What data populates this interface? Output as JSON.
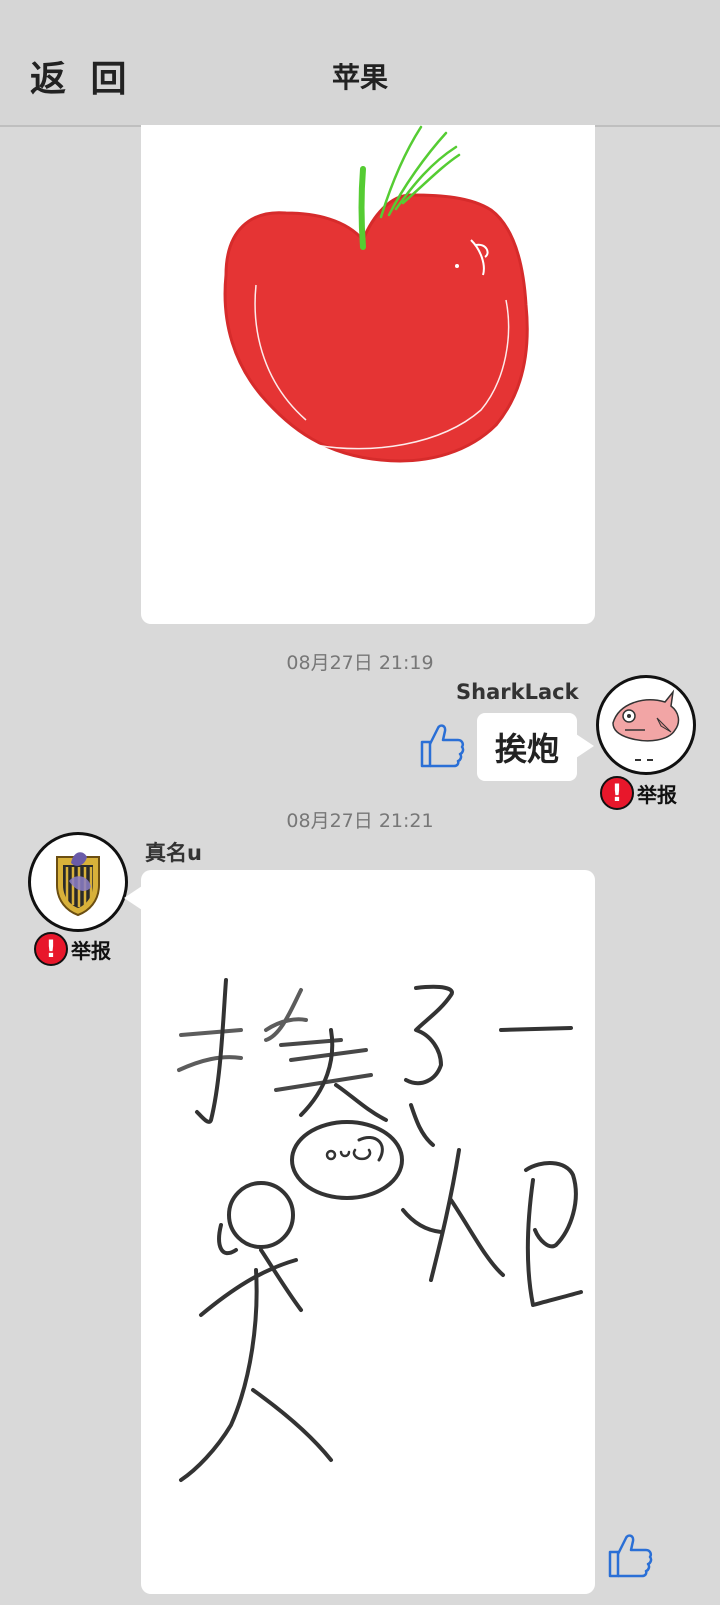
{
  "header": {
    "back_label": "返 回",
    "title": "苹果"
  },
  "messages": [
    {
      "type": "image",
      "image": "apple-drawing"
    },
    {
      "timestamp": "08月27日  21:19",
      "username": "SharkLack",
      "text": "挨炮",
      "report_label": "举报",
      "avatar": "shark-avatar"
    },
    {
      "timestamp": "08月27日  21:21",
      "username": "真名u",
      "image": "handwritten-drawing",
      "report_label": "举报",
      "avatar": "crest-avatar"
    }
  ],
  "colors": {
    "background": "#d9d9d9",
    "apple_red": "#e53434",
    "stem_green": "#55cc33",
    "thumb_blue": "#2a6fd6",
    "report_red": "#e8172b"
  },
  "icons": [
    "thumbs-up-icon",
    "exclamation-icon"
  ]
}
